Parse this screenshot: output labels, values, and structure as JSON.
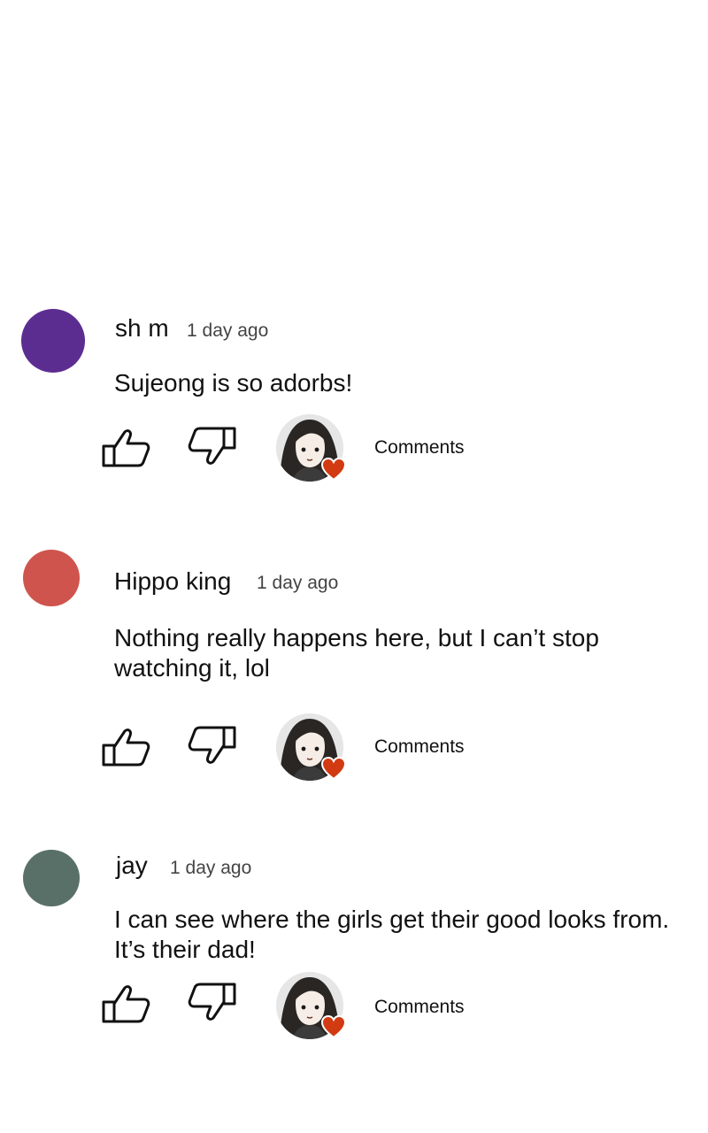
{
  "comments": [
    {
      "author": "sh m",
      "time": "1 day ago",
      "text": "Sujeong is so adorbs!",
      "avatar_color": "#5c2d91",
      "comments_label": "Comments"
    },
    {
      "author": "Hippo king",
      "time": "1 day ago",
      "text": "Nothing really happens here, but I can’t stop watching it, lol",
      "avatar_color": "#cf544d",
      "comments_label": "Comments"
    },
    {
      "author": "jay",
      "time": "1 day ago",
      "text": "I can see where the girls get their good looks from. It’s their dad!",
      "avatar_color": "#597068",
      "comments_label": "Comments"
    }
  ],
  "icons": {
    "like": "thumbs-up-icon",
    "dislike": "thumbs-down-icon",
    "reaction": "heart-icon"
  },
  "colors": {
    "heart": "#d23a12"
  }
}
